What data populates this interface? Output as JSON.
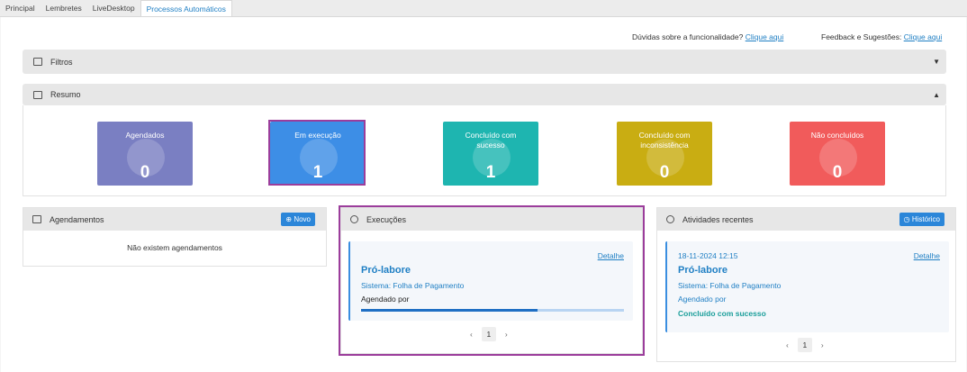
{
  "tabs": [
    "Principal",
    "Lembretes",
    "LiveDesktop",
    "Processos Automáticos"
  ],
  "help": {
    "question_text": "Dúvidas sobre a funcionalidade?",
    "question_link": "Clique aqui",
    "feedback_text": "Feedback e Sugestões:",
    "feedback_link": "Clique aqui"
  },
  "filtros": {
    "title": "Filtros"
  },
  "resumo": {
    "title": "Resumo",
    "stats": [
      {
        "label": "Agendados",
        "value": "0",
        "color": "#7a7fc2"
      },
      {
        "label": "Em execução",
        "value": "1",
        "color": "#3d8ee6"
      },
      {
        "label": "Concluído com sucesso",
        "value": "1",
        "color": "#1eb5b0"
      },
      {
        "label": "Concluído com inconsistência",
        "value": "0",
        "color": "#c9ad12"
      },
      {
        "label": "Não concluídos",
        "value": "0",
        "color": "#f15b5b"
      }
    ]
  },
  "agendamentos": {
    "title": "Agendamentos",
    "button": "Novo",
    "empty": "Não existem agendamentos"
  },
  "execucoes": {
    "title": "Execuções",
    "item": {
      "detail": "Detalhe",
      "title": "Pró-labore",
      "system": "Sistema: Folha de Pagamento",
      "scheduled": "Agendado por",
      "progress": 0.67
    },
    "page": "1"
  },
  "atividades": {
    "title": "Atividades recentes",
    "button": "Histórico",
    "item": {
      "datetime": "18-11-2024 12:15",
      "detail": "Detalhe",
      "title": "Pró-labore",
      "system": "Sistema: Folha de Pagamento",
      "scheduled": "Agendado por",
      "status": "Concluído com sucesso"
    },
    "page": "1"
  },
  "icons": {
    "prev": "chevron-left-icon",
    "next": "chevron-right-icon",
    "collapse_down": "caret-down-icon",
    "collapse_up": "caret-up-icon"
  }
}
